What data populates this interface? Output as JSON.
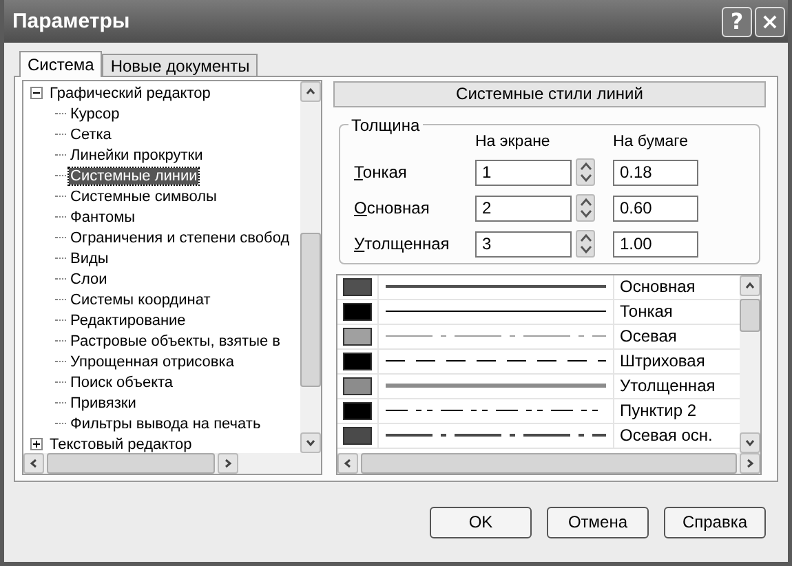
{
  "window": {
    "title": "Параметры",
    "help_button": "?",
    "close_button": "×"
  },
  "tabs": [
    {
      "label": "Система",
      "selected": true
    },
    {
      "label": "Новые документы",
      "selected": false
    }
  ],
  "tree": [
    {
      "label": "Графический редактор",
      "expanded": true,
      "selected": false,
      "children": [
        {
          "label": "Курсор",
          "selected": false
        },
        {
          "label": "Сетка",
          "selected": false
        },
        {
          "label": "Линейки прокрутки",
          "selected": false
        },
        {
          "label": "Системные линии",
          "selected": true
        },
        {
          "label": "Системные символы",
          "selected": false
        },
        {
          "label": "Фантомы",
          "selected": false
        },
        {
          "label": "Ограничения и степени свобод",
          "selected": false
        },
        {
          "label": "Виды",
          "selected": false
        },
        {
          "label": "Слои",
          "selected": false
        },
        {
          "label": "Системы координат",
          "selected": false
        },
        {
          "label": "Редактирование",
          "selected": false
        },
        {
          "label": "Растровые объекты, взятые в",
          "selected": false
        },
        {
          "label": "Упрощенная отрисовка",
          "selected": false
        },
        {
          "label": "Поиск объекта",
          "selected": false
        },
        {
          "label": "Привязки",
          "selected": false
        },
        {
          "label": "Фильтры вывода на печать",
          "selected": false
        }
      ]
    },
    {
      "label": "Текстовый редактор",
      "expanded": false,
      "selected": false
    }
  ],
  "panel": {
    "title": "Системные стили линий",
    "thickness": {
      "legend": "Толщина",
      "column_screen": "На экране",
      "column_paper": "На бумаге",
      "rows": [
        {
          "label": "Тонкая",
          "screen": "1",
          "paper": "0.18"
        },
        {
          "label": "Основная",
          "screen": "2",
          "paper": "0.60"
        },
        {
          "label": "Утолщенная",
          "screen": "3",
          "paper": "1.00"
        }
      ]
    },
    "line_styles": [
      {
        "name": "Основная",
        "color": "#505050",
        "kind": "main"
      },
      {
        "name": "Тонкая",
        "color": "#000000",
        "kind": "thin"
      },
      {
        "name": "Осевая",
        "color": "#a0a0a0",
        "kind": "axial"
      },
      {
        "name": "Штриховая",
        "color": "#000000",
        "kind": "dashed"
      },
      {
        "name": "Утолщенная",
        "color": "#8c8c8c",
        "kind": "thick"
      },
      {
        "name": "Пунктир 2",
        "color": "#000000",
        "kind": "dotted"
      },
      {
        "name": "Осевая осн.",
        "color": "#4a4a4a",
        "kind": "axialmain"
      }
    ]
  },
  "buttons": [
    "OK",
    "Отмена",
    "Справка"
  ]
}
